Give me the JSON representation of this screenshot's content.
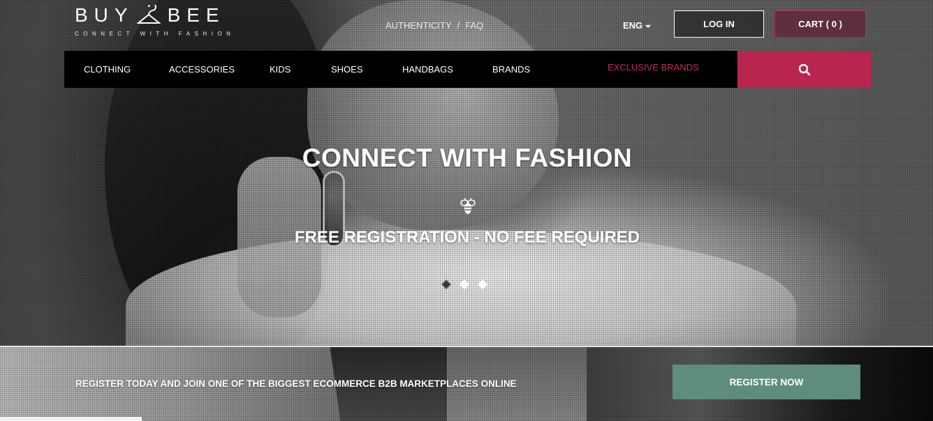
{
  "header": {
    "logo": {
      "left": "BUY",
      "right": "BEE",
      "tagline": "CONNECT WITH FASHION"
    },
    "top_links": [
      "AUTHENTICITY",
      "/",
      "FAQ"
    ],
    "language": "ENG",
    "login_label": "LOG IN",
    "cart_label": "CART ( 0 )"
  },
  "nav": {
    "items": [
      "CLOTHING",
      "ACCESSORIES",
      "KIDS",
      "SHOES",
      "HANDBAGS",
      "BRANDS"
    ],
    "exclusive": "EXCLUSIVE BRANDS",
    "search_icon": "search-icon"
  },
  "hero": {
    "title": "CONNECT WITH FASHION",
    "subtitle": "FREE REGISTRATION - NO FEE REQUIRED",
    "slide_count": 3,
    "active_slide": 1
  },
  "register_band": {
    "text": "REGISTER TODAY AND JOIN ONE OF THE BIGGEST ECOMMERCE B2B MARKETPLACES ONLINE",
    "button_label": "REGISTER NOW"
  },
  "colors": {
    "accent": "#b8264f",
    "register_button": "#5e8e7b",
    "nav_bg": "#000000"
  }
}
